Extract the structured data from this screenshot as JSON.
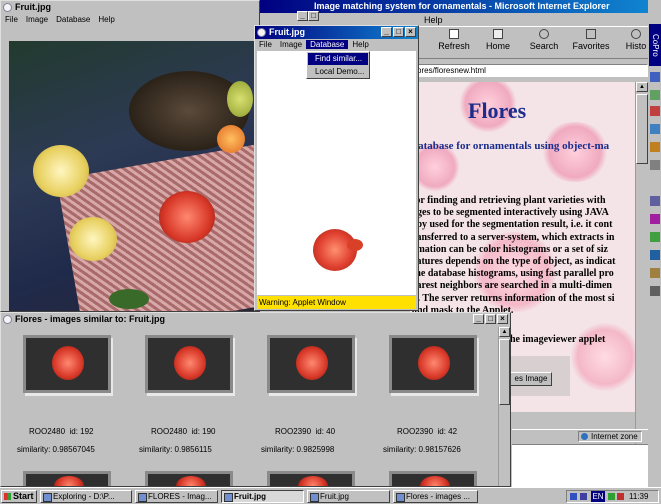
{
  "fruit_left": {
    "title": "Fruit.jpg",
    "menu": [
      "File",
      "Image",
      "Database",
      "Help"
    ]
  },
  "fruit_popup": {
    "title": "Fruit.jpg",
    "menu": [
      "File",
      "Image",
      "Database",
      "Help"
    ],
    "dropdown": [
      "Find similar...",
      "Local Demo..."
    ],
    "status": "Warning: Applet Window"
  },
  "ie": {
    "title": "Image matching system for ornamentals - Microsoft Internet Explorer",
    "menu_help": "Help",
    "toolbar": [
      "Refresh",
      "Home",
      "Search",
      "Favorites",
      "Histo"
    ],
    "address": "flores/floresnew.html",
    "heading": "Flores",
    "subheading": "database for ornamentals using object-ma",
    "body_lines": [
      "for finding and retrieving plant varieties with",
      "ages to be segmented interactively using JAVA",
      "eby used for the segmentation result, i.e. it cont",
      "ransferred to a server-system, which extracts in",
      "rmation can be color histograms or a set of siz",
      "eatures depends on the type of object, as indicat",
      "the database histograms, using fast parallel pro",
      "earest neighbors are searched in a multi-dimen",
      "n. The server returns information of the most si",
      "and mask to the Applet."
    ],
    "applet_line": "he imageviewer applet",
    "button": "es Image",
    "zone": "Internet zone"
  },
  "results": {
    "title": "Flores - images similar to: Fruit.jpg",
    "items": [
      {
        "id": "ROO2480  id: 192",
        "sim": "similarity: 0.98567045"
      },
      {
        "id": "ROO2480  id: 190",
        "sim": "similarity: 0.9856115"
      },
      {
        "id": "ROO2390  id: 40",
        "sim": "similarity: 0.9825998"
      },
      {
        "id": "ROO2390  id: 42",
        "sim": "similarity: 0.98157626"
      }
    ]
  },
  "side_labels": [
    "Co",
    "Pro"
  ],
  "taskbar": {
    "start": "Start",
    "buttons": [
      "Exploring - D:\\P...",
      "FLORES - Imag...",
      "Fruit.jpg",
      "Fruit.jpg",
      "Flores - images ..."
    ],
    "tray": "EN",
    "clock": "11:39"
  }
}
